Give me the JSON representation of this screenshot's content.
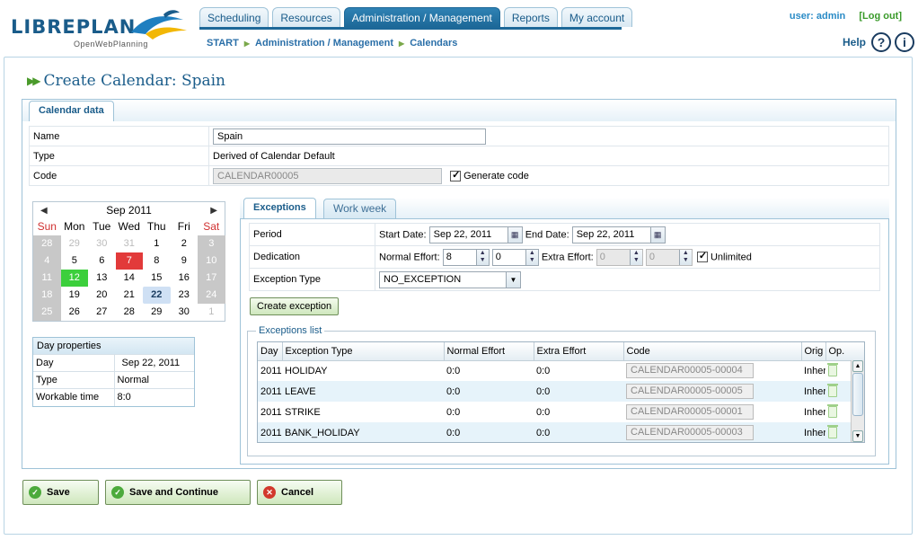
{
  "header": {
    "logo_main": "LIBREPLAN",
    "logo_sub": "OpenWebPlanning",
    "tabs": [
      {
        "label": "Scheduling"
      },
      {
        "label": "Resources"
      },
      {
        "label": "Administration / Management"
      },
      {
        "label": "Reports"
      },
      {
        "label": "My account"
      }
    ],
    "user_text": "user: admin",
    "logout": "[Log out]",
    "help": "Help",
    "help_q": "?",
    "help_i": "i"
  },
  "breadcrumb": [
    "START",
    "Administration / Management",
    "Calendars"
  ],
  "page": {
    "title": "Create Calendar: Spain",
    "outer_tab": "Calendar data"
  },
  "form": {
    "name_label": "Name",
    "name_value": "Spain",
    "type_label": "Type",
    "type_value": "Derived of Calendar Default",
    "code_label": "Code",
    "code_value": "CALENDAR00005",
    "generate_code": "Generate code"
  },
  "calendar": {
    "month": "Sep 2011",
    "weekdays": [
      "Sun",
      "Mon",
      "Tue",
      "Wed",
      "Thu",
      "Fri",
      "Sat"
    ],
    "rows": [
      [
        "28",
        "29",
        "30",
        "31",
        "1",
        "2",
        "3"
      ],
      [
        "4",
        "5",
        "6",
        "7",
        "8",
        "9",
        "10"
      ],
      [
        "11",
        "12",
        "13",
        "14",
        "15",
        "16",
        "17"
      ],
      [
        "18",
        "19",
        "20",
        "21",
        "22",
        "23",
        "24"
      ],
      [
        "25",
        "26",
        "27",
        "28",
        "29",
        "30",
        "1"
      ]
    ]
  },
  "day_properties": {
    "title": "Day properties",
    "rows": [
      {
        "label": "Day",
        "value": "Sep 22, 2011"
      },
      {
        "label": "Type",
        "value": "Normal"
      },
      {
        "label": "Workable time",
        "value": "8:0"
      }
    ]
  },
  "exceptions": {
    "tab_exceptions": "Exceptions",
    "tab_workweek": "Work week",
    "period_label": "Period",
    "start_label": "Start Date:",
    "start_value": "Sep 22, 2011",
    "end_label": "End Date:",
    "end_value": "Sep 22, 2011",
    "dedication_label": "Dedication",
    "normal_effort_label": "Normal Effort:",
    "normal_h": "8",
    "normal_m": "0",
    "extra_effort_label": "Extra Effort:",
    "extra_h": "0",
    "extra_m": "0",
    "unlimited": "Unlimited",
    "type_label": "Exception Type",
    "type_value": "NO_EXCEPTION",
    "create_button": "Create exception",
    "list_title": "Exceptions list",
    "columns": [
      "Day",
      "Exception Type",
      "Normal Effort",
      "Extra Effort",
      "Code",
      "Orig",
      "Op."
    ],
    "rows": [
      {
        "day": "2011",
        "type": "HOLIDAY",
        "normal": "0:0",
        "extra": "0:0",
        "code": "CALENDAR00005-00004",
        "origin": "Inher"
      },
      {
        "day": "2011",
        "type": "LEAVE",
        "normal": "0:0",
        "extra": "0:0",
        "code": "CALENDAR00005-00005",
        "origin": "Inher"
      },
      {
        "day": "2011",
        "type": "STRIKE",
        "normal": "0:0",
        "extra": "0:0",
        "code": "CALENDAR00005-00001",
        "origin": "Inher"
      },
      {
        "day": "2011",
        "type": "BANK_HOLIDAY",
        "normal": "0:0",
        "extra": "0:0",
        "code": "CALENDAR00005-00003",
        "origin": "Inher"
      }
    ]
  },
  "actions": {
    "save": "Save",
    "save_continue": "Save and Continue",
    "cancel": "Cancel"
  },
  "colors": {
    "accent": "#1d6898",
    "link": "#2a6fa8",
    "weekend_header": "#d03030",
    "holiday_red": "#e23a3a",
    "today_green": "#3ccf3c"
  }
}
